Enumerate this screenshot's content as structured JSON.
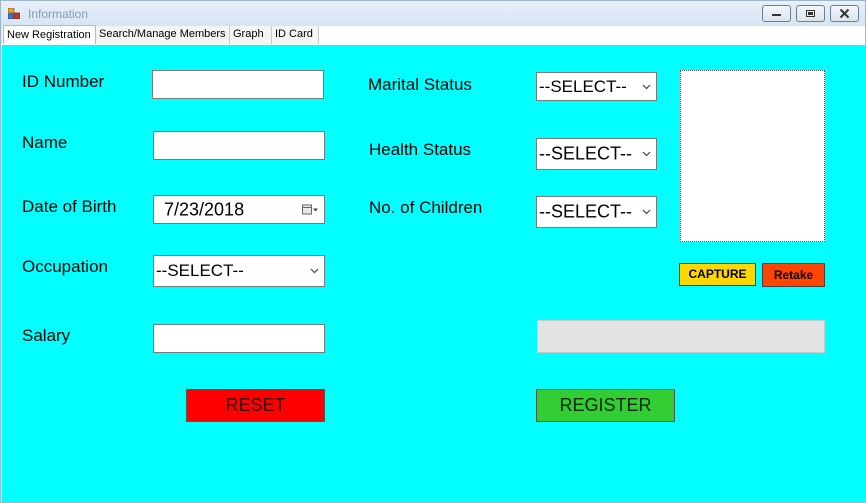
{
  "window": {
    "title": "Information",
    "controls": [
      "minimize-icon",
      "restore-icon",
      "close-icon"
    ]
  },
  "tabs": [
    {
      "label": "New Registration",
      "active": true
    },
    {
      "label": "Search/Manage Members",
      "active": false
    },
    {
      "label": "Graph",
      "active": false
    },
    {
      "label": "ID Card",
      "active": false
    }
  ],
  "form": {
    "id_number": {
      "label": "ID Number",
      "value": ""
    },
    "name": {
      "label": "Name",
      "value": ""
    },
    "date_of_birth": {
      "label": "Date of Birth",
      "value": "7/23/2018"
    },
    "occupation": {
      "label": "Occupation",
      "value": "--SELECT--"
    },
    "salary": {
      "label": "Salary",
      "value": ""
    },
    "marital_status": {
      "label": "Marital Status",
      "value": "--SELECT--"
    },
    "health_status": {
      "label": "Health Status",
      "value": "--SELECT--"
    },
    "children": {
      "label": "No. of Children",
      "value": "--SELECT--"
    }
  },
  "photo": {
    "capture_label": "CAPTURE",
    "retake_label": "Retake"
  },
  "status_value": "",
  "actions": {
    "reset_label": "RESET",
    "register_label": "REGISTER"
  },
  "colors": {
    "panel_background": "#00ffff",
    "reset_button": "#ff0000",
    "register_button": "#32cd32",
    "capture_button": "#ffd700",
    "retake_button": "#ff4500"
  }
}
